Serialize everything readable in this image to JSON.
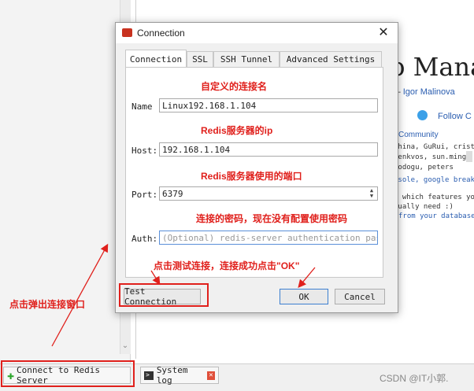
{
  "bottom_bar": {
    "connect_label": "Connect to Redis Server",
    "syslog_label": "System log"
  },
  "watermark": "CSDN @IT小郭.",
  "background": {
    "title": "p Mana",
    "author_prefix": "y – ",
    "author_name": "Igor Malinova",
    "follow": "Follow C",
    "community": "Community",
    "lines": [
      "china, GuRui, crist",
      "henkvos, sun.ming.",
      "rodogu, peters",
      "nsole, google breakp",
      "k which features yo",
      "tually need :)",
      "from your database"
    ]
  },
  "dialog": {
    "title": "Connection",
    "tabs": [
      "Connection",
      "SSL",
      "SSH Tunnel",
      "Advanced Settings"
    ],
    "name_label": "Name",
    "name_value": "Linux192.168.1.104",
    "host_label": "Host:",
    "host_value": "192.168.1.104",
    "port_label": "Port:",
    "port_value": "6379",
    "auth_label": "Auth:",
    "auth_placeholder": "(Optional) redis-server authentication pas···",
    "test_button": "Test Connection",
    "ok_button": "OK",
    "cancel_button": "Cancel"
  },
  "annotations": {
    "name_note": "自定义的连接名",
    "host_note": "Redis服务器的ip",
    "port_note": "Redis服务器使用的端口",
    "auth_note": "连接的密码，现在没有配置使用密码",
    "test_note": "点击测试连接，连接成功点击\"OK\"",
    "connect_note": "点击弹出连接窗口"
  },
  "colors": {
    "annotation": "#e0201c",
    "accent": "#3c7fd0",
    "plus": "#2aa52a"
  }
}
